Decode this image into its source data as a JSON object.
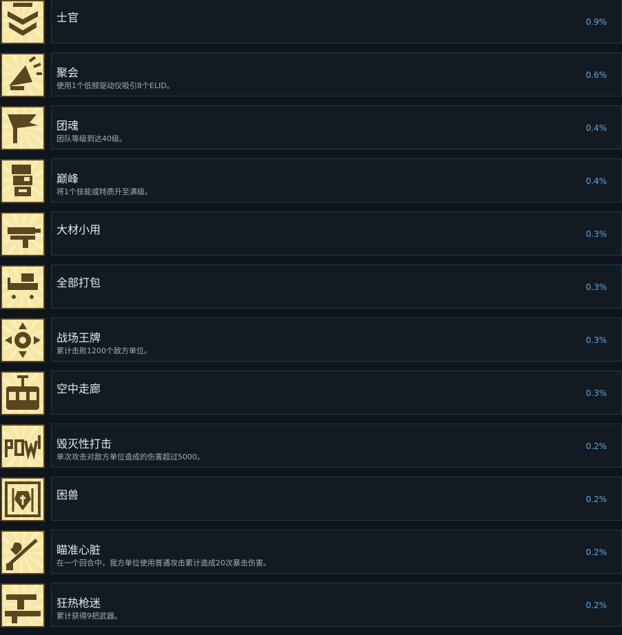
{
  "achievements": [
    {
      "title": "士官",
      "desc": "",
      "pct": "0.9%",
      "icon": "chevron-rank-icon"
    },
    {
      "title": "聚会",
      "desc": "使用1个低频驱动仪吸引8个ELID。",
      "pct": "0.6%",
      "icon": "megaphone-icon"
    },
    {
      "title": "团魂",
      "desc": "团队等级到达40级。",
      "pct": "0.4%",
      "icon": "flag-icon"
    },
    {
      "title": "巅峰",
      "desc": "将1个技能或特质升至满级。",
      "pct": "0.4%",
      "icon": "soldier-head-icon"
    },
    {
      "title": "大材小用",
      "desc": "",
      "pct": "0.3%",
      "icon": "big-gun-icon"
    },
    {
      "title": "全部打包",
      "desc": "",
      "pct": "0.3%",
      "icon": "cargo-cart-icon"
    },
    {
      "title": "战场王牌",
      "desc": "累计击败1200个敌方单位。",
      "pct": "0.3%",
      "icon": "ace-emblem-icon"
    },
    {
      "title": "空中走廊",
      "desc": "",
      "pct": "0.3%",
      "icon": "cable-car-icon"
    },
    {
      "title": "毁灭性打击",
      "desc": "单次攻击对敌方单位造成的伤害超过5000。",
      "pct": "0.2%",
      "icon": "pow-text-icon"
    },
    {
      "title": "困兽",
      "desc": "",
      "pct": "0.2%",
      "icon": "caged-beast-icon"
    },
    {
      "title": "瞄准心脏",
      "desc": "在一个回合中，我方单位使用普通攻击累计造成20次暴击伤害。",
      "pct": "0.2%",
      "icon": "heart-target-icon"
    },
    {
      "title": "狂热枪迷",
      "desc": "累计获得9把武器。",
      "pct": "0.2%",
      "icon": "rifle-icon"
    }
  ],
  "colors": {
    "background": "#0f151c",
    "card": "#131a22",
    "card_border": "#1f3a4c",
    "percent": "#5aa9e6",
    "badge_light": "#f7e6a4",
    "badge_dark": "#5a4620"
  }
}
